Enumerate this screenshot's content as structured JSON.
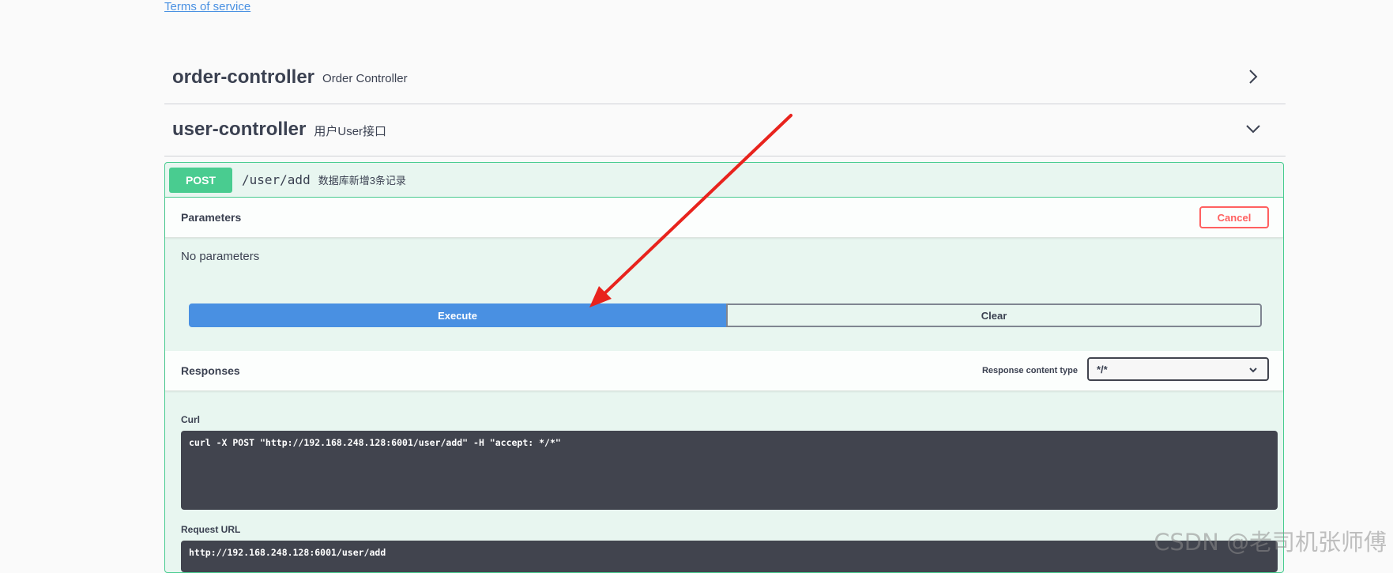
{
  "info": {
    "terms_link": "Terms of service"
  },
  "tags": [
    {
      "name": "order-controller",
      "description": "Order Controller",
      "expanded": false
    },
    {
      "name": "user-controller",
      "description": "用户User接口",
      "expanded": true
    }
  ],
  "operation": {
    "method": "POST",
    "path": "/user/add",
    "summary": "数据库新增3条记录",
    "parameters_title": "Parameters",
    "cancel_label": "Cancel",
    "no_parameters": "No parameters",
    "execute_label": "Execute",
    "clear_label": "Clear",
    "responses_title": "Responses",
    "response_content_type_label": "Response content type",
    "response_content_type_value": "*/*",
    "curl_label": "Curl",
    "curl_command": "curl -X POST \"http://192.168.248.128:6001/user/add\" -H \"accept: */*\"",
    "request_url_label": "Request URL",
    "request_url": "http://192.168.248.128:6001/user/add"
  },
  "watermark": "CSDN @老司机张师傅",
  "colors": {
    "post": "#49cc90",
    "execute": "#4990e2",
    "cancel": "#ff6060",
    "code_bg": "#41444e",
    "annotation_arrow": "#e8231d"
  }
}
